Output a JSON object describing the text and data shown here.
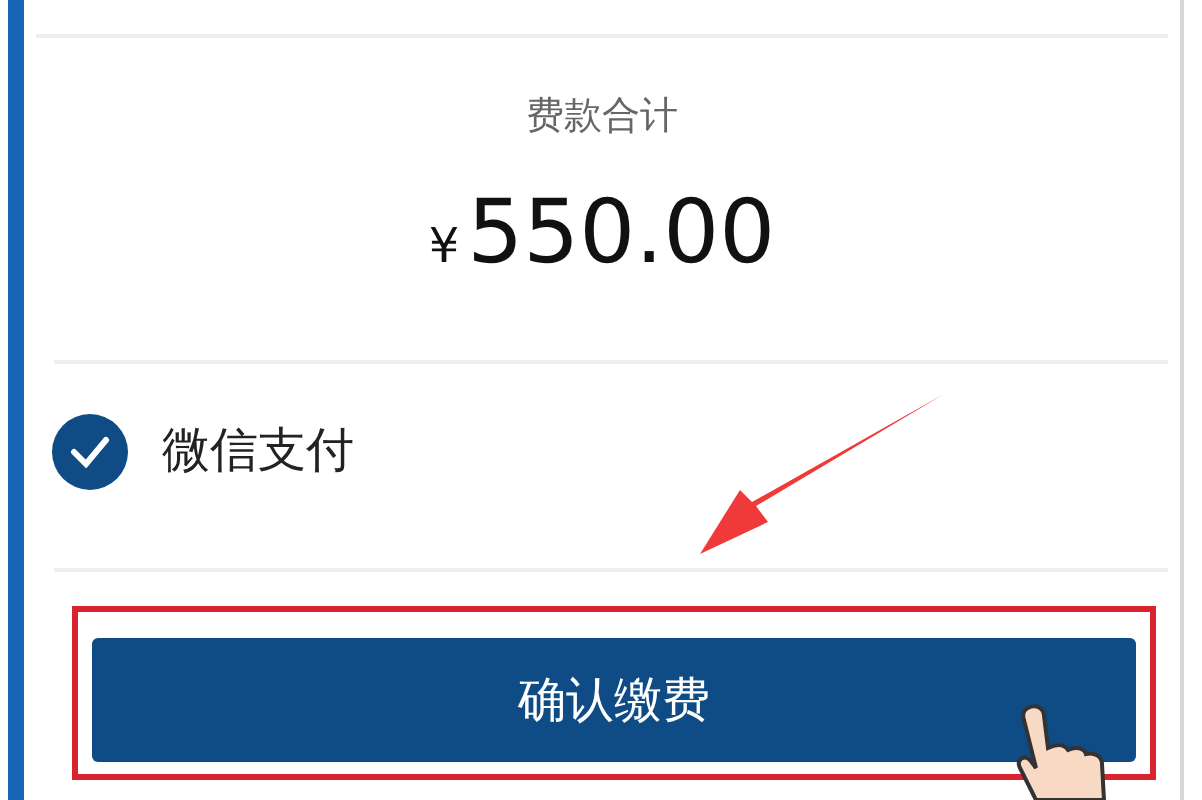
{
  "total": {
    "label": "费款合计",
    "currency": "¥",
    "amount": "550.00"
  },
  "payment_methods": [
    {
      "label": "微信支付",
      "checked": true
    }
  ],
  "confirm_button": {
    "label": "确认缴费"
  }
}
